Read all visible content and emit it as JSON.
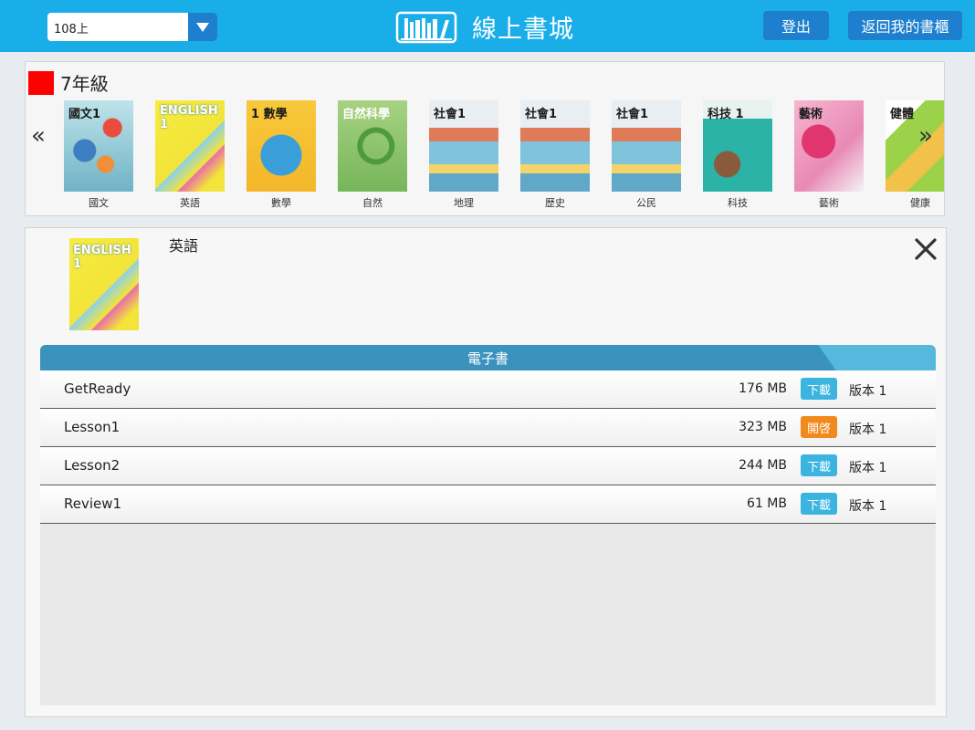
{
  "header": {
    "semester_value": "108上",
    "title": "線上書城",
    "logout_label": "登出",
    "back_label": "返回我的書櫃",
    "bg_color": "#1aaee8",
    "button_color": "#1e7fcf"
  },
  "grade": {
    "label": "7年級",
    "marker_color": "#ff0000",
    "prev_label": "«",
    "next_label": "»",
    "books": [
      {
        "name": "國文",
        "cover_text": "國文1",
        "color": "#8ec9d6"
      },
      {
        "name": "英語",
        "cover_text": "ENGLISH 1",
        "color": "#f2e43a"
      },
      {
        "name": "數學",
        "cover_text": "1 數學",
        "color": "#f5c330"
      },
      {
        "name": "自然",
        "cover_text": "自然科學",
        "color": "#8cc36b"
      },
      {
        "name": "地理",
        "cover_text": "社會1",
        "color": "#7fc4dc"
      },
      {
        "name": "歷史",
        "cover_text": "社會1",
        "color": "#7fc4dc"
      },
      {
        "name": "公民",
        "cover_text": "社會1",
        "color": "#7fc4dc"
      },
      {
        "name": "科技",
        "cover_text": "科技 1",
        "color": "#2bb3a8"
      },
      {
        "name": "藝術",
        "cover_text": "藝術",
        "color": "#e88ab5"
      },
      {
        "name": "健康",
        "cover_text": "健體",
        "color": "#9bd24a"
      }
    ]
  },
  "detail": {
    "name": "英語",
    "cover_text": "ENGLISH 1",
    "section_label": "電子書",
    "files": [
      {
        "name": "GetReady",
        "size": "176 MB",
        "action": "下載",
        "action_type": "download",
        "version": "版本 1"
      },
      {
        "name": "Lesson1",
        "size": "323 MB",
        "action": "開啓",
        "action_type": "open",
        "version": "版本 1"
      },
      {
        "name": "Lesson2",
        "size": "244 MB",
        "action": "下載",
        "action_type": "download",
        "version": "版本 1"
      },
      {
        "name": "Review1",
        "size": "61 MB",
        "action": "下載",
        "action_type": "download",
        "version": "版本 1"
      }
    ]
  }
}
